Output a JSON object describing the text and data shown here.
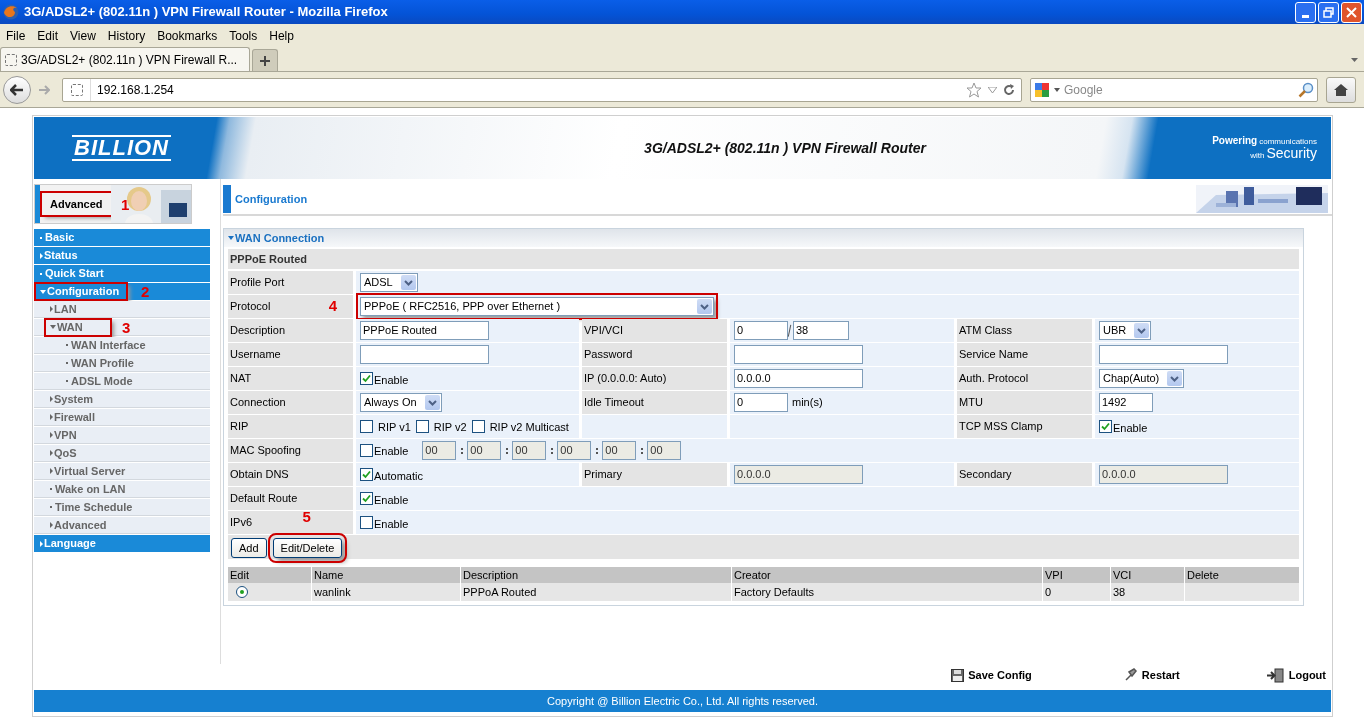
{
  "window": {
    "title": "3G/ADSL2+ (802.11n ) VPN Firewall Router - Mozilla Firefox"
  },
  "menu": [
    "File",
    "Edit",
    "View",
    "History",
    "Bookmarks",
    "Tools",
    "Help"
  ],
  "tabs": [
    {
      "label": "3G/ADSL2+ (802.11n ) VPN Firewall R...",
      "selected": true
    }
  ],
  "address_bar": {
    "value": "192.168.1.254"
  },
  "search": {
    "placeholder": "Google"
  },
  "banner": {
    "logo": "BILLION",
    "title": "3G/ADSL2+ (802.11n ) VPN Firewall Router",
    "tagline_top": "Powering",
    "tagline_small": "communications",
    "tagline_with": "with",
    "tagline_bottom": "Security"
  },
  "mode": {
    "label": "Advanced",
    "callout": "1"
  },
  "sidebar": {
    "items": [
      {
        "label": "Basic"
      },
      {
        "label": "Status",
        "expanded": false
      },
      {
        "label": "Quick Start"
      },
      {
        "label": "Configuration",
        "expanded": true,
        "callout": "2",
        "children": [
          {
            "label": "LAN",
            "expanded": false
          },
          {
            "label": "WAN",
            "expanded": true,
            "callout": "3",
            "children": [
              {
                "label": "WAN Interface"
              },
              {
                "label": "WAN Profile"
              },
              {
                "label": "ADSL Mode"
              }
            ]
          },
          {
            "label": "System",
            "expanded": false
          },
          {
            "label": "Firewall",
            "expanded": false
          },
          {
            "label": "VPN",
            "expanded": false
          },
          {
            "label": "QoS",
            "expanded": false
          },
          {
            "label": "Virtual Server",
            "expanded": false
          },
          {
            "label": "Wake on LAN"
          },
          {
            "label": "Time Schedule"
          },
          {
            "label": "Advanced",
            "expanded": false
          }
        ]
      },
      {
        "label": "Language",
        "expanded": false
      }
    ]
  },
  "page_title": "Configuration",
  "panel": {
    "title": "WAN Connection",
    "expanded": true,
    "subtitle": "PPPoE Routed",
    "rows": [
      {
        "cells": [
          {
            "label": "Profile Port",
            "control": {
              "kind": "select",
              "value": "ADSL"
            }
          }
        ]
      },
      {
        "callout": "4",
        "cells": [
          {
            "label": "Protocol",
            "control": {
              "kind": "long-select",
              "value": "PPPoE ( RFC2516, PPP over Ethernet )"
            }
          }
        ]
      },
      {
        "cells": [
          {
            "label": "Description",
            "control": {
              "kind": "text",
              "value": "PPPoE Routed",
              "disabled": false
            }
          },
          {
            "label": "VPI/VCI",
            "control": {
              "kind": "pair",
              "first": "0",
              "second": "38"
            }
          },
          {
            "label": "ATM Class",
            "control": {
              "kind": "select",
              "value": "UBR"
            }
          }
        ]
      },
      {
        "cells": [
          {
            "label": "Username",
            "control": {
              "kind": "text",
              "disabled": false
            }
          },
          {
            "label": "Password",
            "control": {
              "kind": "text",
              "disabled": false
            }
          },
          {
            "label": "Service Name",
            "control": {
              "kind": "text",
              "disabled": false
            }
          }
        ]
      },
      {
        "cells": [
          {
            "label": "NAT",
            "control": {
              "kind": "checkbox",
              "label": "Enable",
              "checked": true
            }
          },
          {
            "label": "IP (0.0.0.0: Auto)",
            "control": {
              "kind": "text",
              "value": "0.0.0.0",
              "disabled": false
            }
          },
          {
            "label": "Auth. Protocol",
            "control": {
              "kind": "select",
              "value": "Chap(Auto)"
            }
          }
        ]
      },
      {
        "cells": [
          {
            "label": "Connection",
            "control": {
              "kind": "select",
              "value": "Always On"
            }
          },
          {
            "label": "Idle Timeout",
            "control": {
              "kind": "number",
              "value": "0",
              "unit": "min(s)"
            }
          },
          {
            "label": "MTU",
            "control": {
              "kind": "number",
              "value": "1492"
            }
          }
        ]
      },
      {
        "cells": [
          {
            "label": "RIP",
            "control": {
              "kind": "checkgroup",
              "options": [
                {
                  "label": "RIP v1",
                  "checked": false
                },
                {
                  "label": "RIP v2",
                  "checked": false
                },
                {
                  "label": "RIP v2 Multicast",
                  "checked": false
                }
              ]
            }
          },
          null,
          {
            "label": "TCP MSS Clamp",
            "control": {
              "kind": "checkbox",
              "label": "Enable",
              "checked": true
            }
          }
        ]
      },
      {
        "cells": [
          {
            "label": "MAC Spoofing",
            "control": {
              "kind": "mac",
              "label": "Enable",
              "checked": false,
              "disabled": true,
              "octets": [
                "00",
                "00",
                "00",
                "00",
                "00",
                "00"
              ]
            }
          }
        ]
      },
      {
        "cells": [
          {
            "label": "Obtain DNS",
            "control": {
              "kind": "checkbox",
              "label": "Automatic",
              "checked": true
            }
          },
          {
            "label": "Primary",
            "control": {
              "kind": "text",
              "value": "0.0.0.0",
              "disabled": true
            }
          },
          {
            "label": "Secondary",
            "control": {
              "kind": "text",
              "value": "0.0.0.0",
              "disabled": true
            }
          }
        ]
      },
      {
        "cells": [
          {
            "label": "Default Route",
            "control": {
              "kind": "checkbox",
              "label": "Enable",
              "checked": true
            }
          }
        ]
      },
      {
        "cells": [
          {
            "label": "IPv6",
            "control": {
              "kind": "checkbox",
              "label": "Enable",
              "checked": false
            }
          }
        ]
      }
    ],
    "buttons": [
      {
        "label": "Add"
      },
      {
        "label": "Edit/Delete",
        "callout": "5"
      }
    ]
  },
  "table": {
    "columns": [
      "Edit",
      "Name",
      "Description",
      "Creator",
      "VPI",
      "VCI",
      "Delete"
    ],
    "rows": [
      {
        "selected": true,
        "cells": [
          null,
          "wanlink",
          "PPPoA Routed",
          "Factory Defaults",
          "0",
          "38",
          null
        ]
      }
    ]
  },
  "footer_links": [
    {
      "kind": "save",
      "label": "Save Config"
    },
    {
      "kind": "restart",
      "label": "Restart"
    },
    {
      "kind": "logout",
      "label": "Logout"
    }
  ],
  "copyright": "Copyright @ Billion Electric Co., Ltd. All rights reserved."
}
